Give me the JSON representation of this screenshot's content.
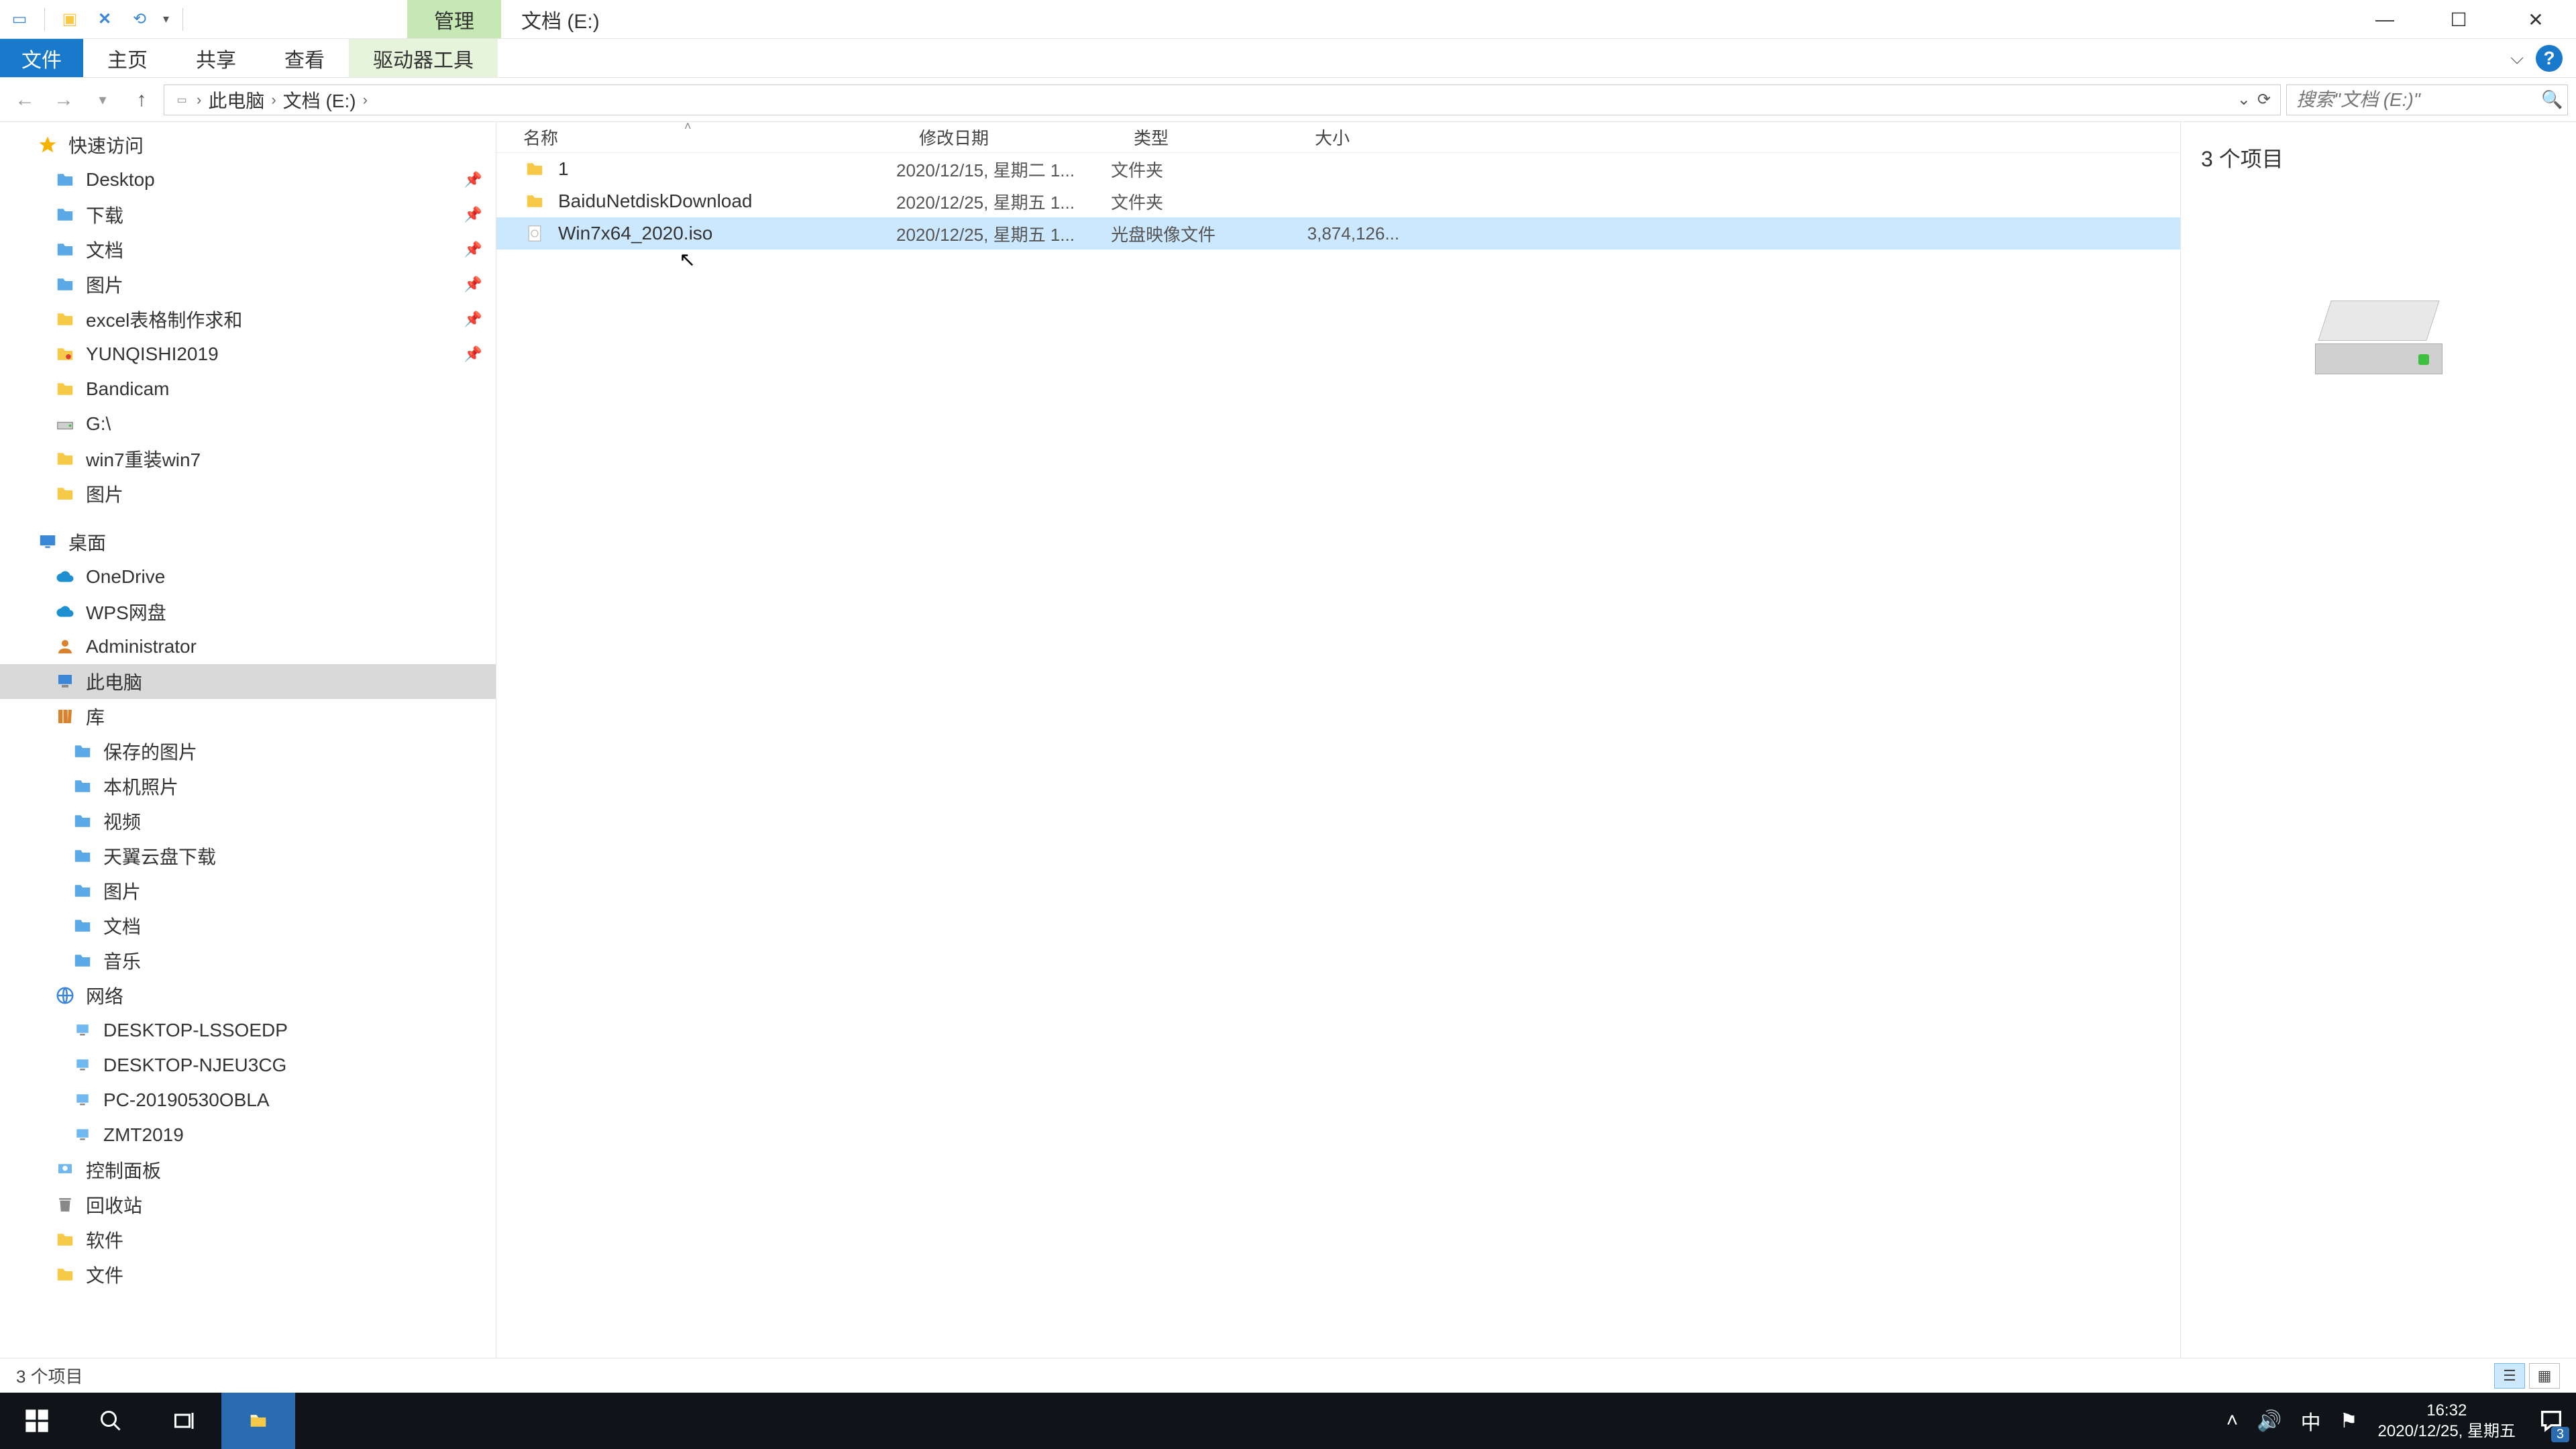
{
  "titlebar": {
    "tab_manage": "管理",
    "title": "文档 (E:)"
  },
  "ribbon": {
    "file": "文件",
    "home": "主页",
    "share": "共享",
    "view": "查看",
    "drive_tools": "驱动器工具"
  },
  "breadcrumb": {
    "root": "此电脑",
    "current": "文档 (E:)"
  },
  "search": {
    "placeholder": "搜索\"文档 (E:)\""
  },
  "preview": {
    "count_label": "3 个项目"
  },
  "status": {
    "count_label": "3 个项目"
  },
  "columns": {
    "name": "名称",
    "date": "修改日期",
    "type": "类型",
    "size": "大小"
  },
  "rows": [
    {
      "name": "1",
      "date": "2020/12/15, 星期二 1...",
      "type": "文件夹",
      "size": "",
      "kind": "folder",
      "selected": false
    },
    {
      "name": "BaiduNetdiskDownload",
      "date": "2020/12/25, 星期五 1...",
      "type": "文件夹",
      "size": "",
      "kind": "folder",
      "selected": false
    },
    {
      "name": "Win7x64_2020.iso",
      "date": "2020/12/25, 星期五 1...",
      "type": "光盘映像文件",
      "size": "3,874,126...",
      "kind": "iso",
      "selected": true
    }
  ],
  "tree": [
    {
      "label": "快速访问",
      "icon": "star",
      "indent": 0,
      "pinned": false
    },
    {
      "label": "Desktop",
      "icon": "folder-b",
      "indent": 1,
      "pinned": true
    },
    {
      "label": "下载",
      "icon": "folder-b",
      "indent": 1,
      "pinned": true
    },
    {
      "label": "文档",
      "icon": "folder-b",
      "indent": 1,
      "pinned": true
    },
    {
      "label": "图片",
      "icon": "folder-b",
      "indent": 1,
      "pinned": true
    },
    {
      "label": "excel表格制作求和",
      "icon": "folder",
      "indent": 1,
      "pinned": true
    },
    {
      "label": "YUNQISHI2019",
      "icon": "folder-sp",
      "indent": 1,
      "pinned": true
    },
    {
      "label": "Bandicam",
      "icon": "folder",
      "indent": 1,
      "pinned": false
    },
    {
      "label": "G:\\",
      "icon": "drive-l",
      "indent": 1,
      "pinned": false
    },
    {
      "label": "win7重装win7",
      "icon": "folder",
      "indent": 1,
      "pinned": false
    },
    {
      "label": "图片",
      "icon": "folder",
      "indent": 1,
      "pinned": false
    },
    {
      "spacer": true
    },
    {
      "label": "桌面",
      "icon": "desktop",
      "indent": 0
    },
    {
      "label": "OneDrive",
      "icon": "cloud",
      "indent": 1
    },
    {
      "label": "WPS网盘",
      "icon": "cloud",
      "indent": 1
    },
    {
      "label": "Administrator",
      "icon": "user",
      "indent": 1
    },
    {
      "label": "此电脑",
      "icon": "pc",
      "indent": 1,
      "selected": true
    },
    {
      "label": "库",
      "icon": "lib",
      "indent": 1
    },
    {
      "label": "保存的图片",
      "icon": "folder-b",
      "indent": 2
    },
    {
      "label": "本机照片",
      "icon": "folder-b",
      "indent": 2
    },
    {
      "label": "视频",
      "icon": "folder-b",
      "indent": 2
    },
    {
      "label": "天翼云盘下载",
      "icon": "folder-b",
      "indent": 2
    },
    {
      "label": "图片",
      "icon": "folder-b",
      "indent": 2
    },
    {
      "label": "文档",
      "icon": "folder-b",
      "indent": 2
    },
    {
      "label": "音乐",
      "icon": "folder-b",
      "indent": 2
    },
    {
      "label": "网络",
      "icon": "net",
      "indent": 1
    },
    {
      "label": "DESKTOP-LSSOEDP",
      "icon": "pc-s",
      "indent": 2
    },
    {
      "label": "DESKTOP-NJEU3CG",
      "icon": "pc-s",
      "indent": 2
    },
    {
      "label": "PC-20190530OBLA",
      "icon": "pc-s",
      "indent": 2
    },
    {
      "label": "ZMT2019",
      "icon": "pc-s",
      "indent": 2
    },
    {
      "label": "控制面板",
      "icon": "cp",
      "indent": 1
    },
    {
      "label": "回收站",
      "icon": "bin",
      "indent": 1
    },
    {
      "label": "软件",
      "icon": "folder",
      "indent": 1
    },
    {
      "label": "文件",
      "icon": "folder",
      "indent": 1
    }
  ],
  "clock": {
    "time": "16:32",
    "date": "2020/12/25, 星期五"
  },
  "notif_count": "3",
  "ime": "中"
}
